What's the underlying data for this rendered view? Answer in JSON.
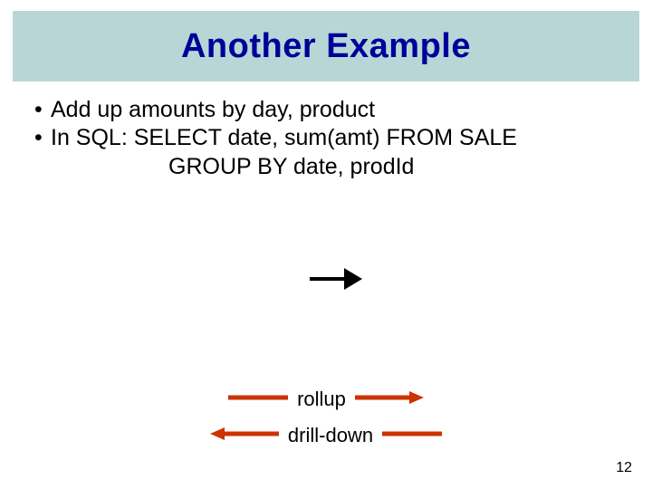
{
  "title": "Another Example",
  "bullets": {
    "b1": "Add up amounts by day, product",
    "b2a": "In SQL:  SELECT date, sum(amt) FROM SALE",
    "b2b": "GROUP BY date, prodId"
  },
  "legend": {
    "rollup": "rollup",
    "drill": "drill-down"
  },
  "page_number": "12",
  "colors": {
    "title_bg": "#b8d6d6",
    "title_fg": "#000099",
    "arrow": "#cc3300"
  }
}
